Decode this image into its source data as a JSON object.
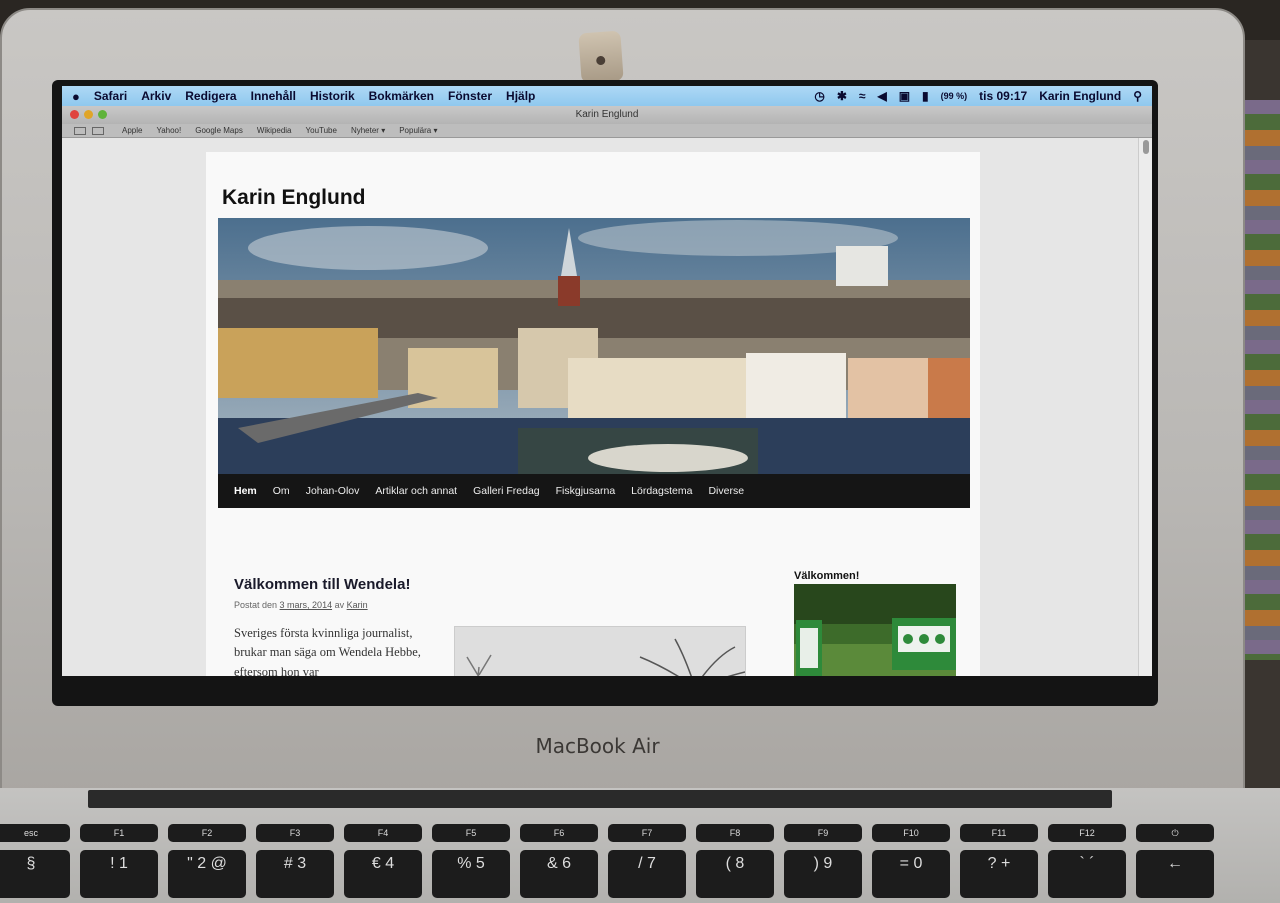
{
  "device": {
    "brand_label": "MacBook Air"
  },
  "menubar": {
    "app_items": [
      "Safari",
      "Arkiv",
      "Redigera",
      "Innehåll",
      "Historik",
      "Bokmärken",
      "Fönster",
      "Hjälp"
    ],
    "battery_text": "(99 %)",
    "clock": "tis 09:17",
    "user": "Karin Englund",
    "icons": [
      "time-machine-icon",
      "bluetooth-icon",
      "wifi-icon",
      "volume-icon",
      "display-icon",
      "battery-icon",
      "spotlight-icon"
    ]
  },
  "browser": {
    "window_title": "Karin Englund",
    "bookmarks": [
      "Apple",
      "Yahoo!",
      "Google Maps",
      "Wikipedia",
      "YouTube",
      "Nyheter ▾",
      "Populära ▾"
    ]
  },
  "site": {
    "title": "Karin Englund",
    "nav": [
      "Hem",
      "Om",
      "Johan-Olov",
      "Artiklar och annat",
      "Galleri Fredag",
      "Fiskgjusarna",
      "Lördagstema",
      "Diverse"
    ],
    "active_nav": "Hem",
    "post": {
      "title": "Välkommen till Wendela!",
      "meta_prefix": "Postat den",
      "meta_date": "3 mars, 2014",
      "meta_by": "av",
      "meta_author": "Karin",
      "body": "Sveriges första kvinnliga journalist, brukar man säga om Wendela Hebbe, eftersom hon var"
    },
    "sidebar": {
      "widget_title": "Välkommen!"
    }
  },
  "keyboard": {
    "function_row": [
      "esc",
      "F1",
      "F2",
      "F3",
      "F4",
      "F5",
      "F6",
      "F7",
      "F8",
      "F9",
      "F10",
      "F11",
      "F12",
      "⏻"
    ],
    "number_row": [
      "§",
      "! 1",
      "\" 2 @",
      "# 3",
      "€ 4",
      "% 5",
      "& 6",
      "/ 7",
      "( 8",
      ") 9",
      "= 0",
      "? +",
      "` ´",
      "←"
    ]
  }
}
